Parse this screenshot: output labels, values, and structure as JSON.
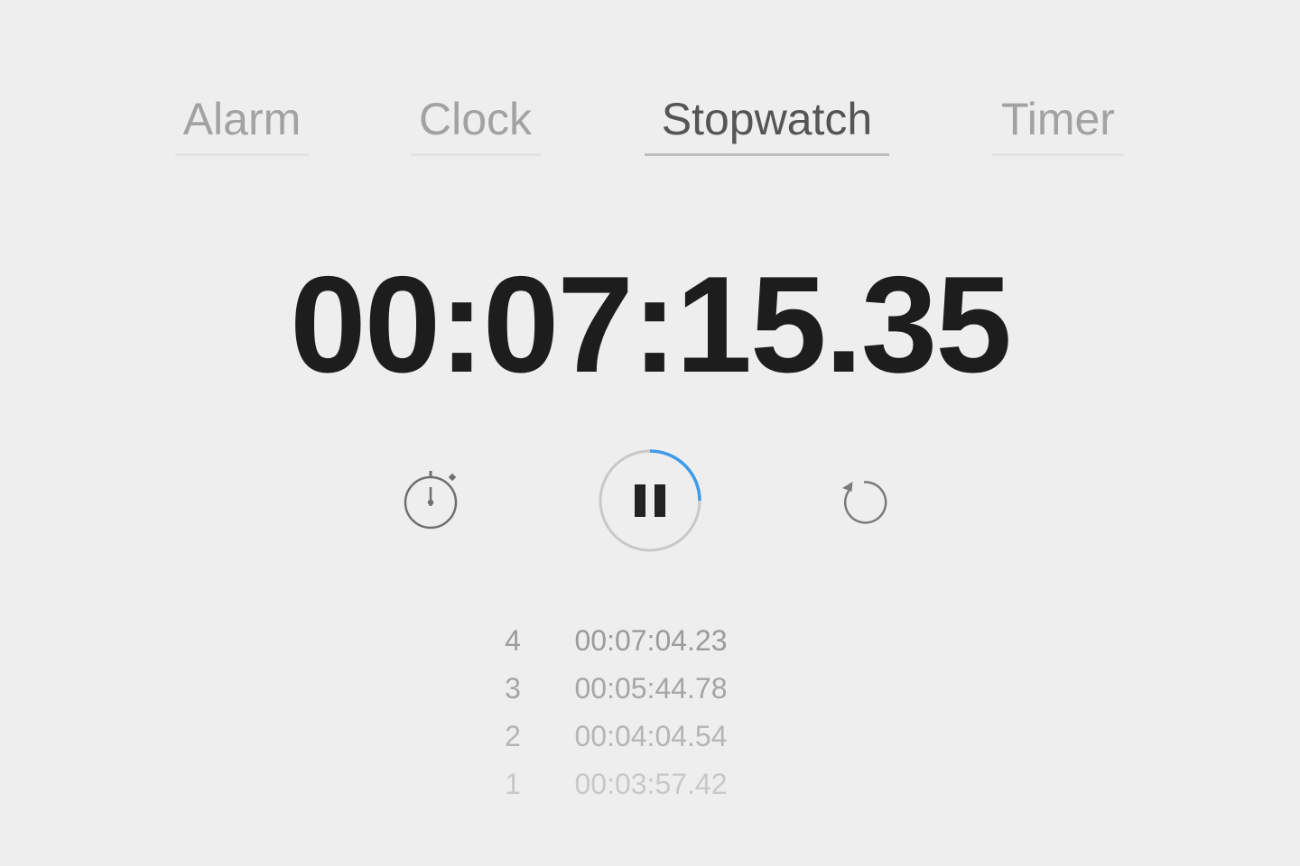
{
  "tabs": [
    {
      "label": "Alarm",
      "active": false
    },
    {
      "label": "Clock",
      "active": false
    },
    {
      "label": "Stopwatch",
      "active": true
    },
    {
      "label": "Timer",
      "active": false
    }
  ],
  "stopwatch": {
    "elapsed": "00:07:15.35",
    "progress_fraction": 0.25
  },
  "controls": {
    "lap_icon": "stopwatch-icon",
    "pause_icon": "pause-icon",
    "reset_icon": "reset-icon"
  },
  "laps": [
    {
      "number": "4",
      "time": "00:07:04.23"
    },
    {
      "number": "3",
      "time": "00:05:44.78"
    },
    {
      "number": "2",
      "time": "00:04:04.54"
    },
    {
      "number": "1",
      "time": "00:03:57.42"
    }
  ],
  "colors": {
    "background": "#eeeeee",
    "progress_accent": "#3d9be9",
    "ring": "#c8c8c8",
    "time_text": "#1d1d1d"
  }
}
